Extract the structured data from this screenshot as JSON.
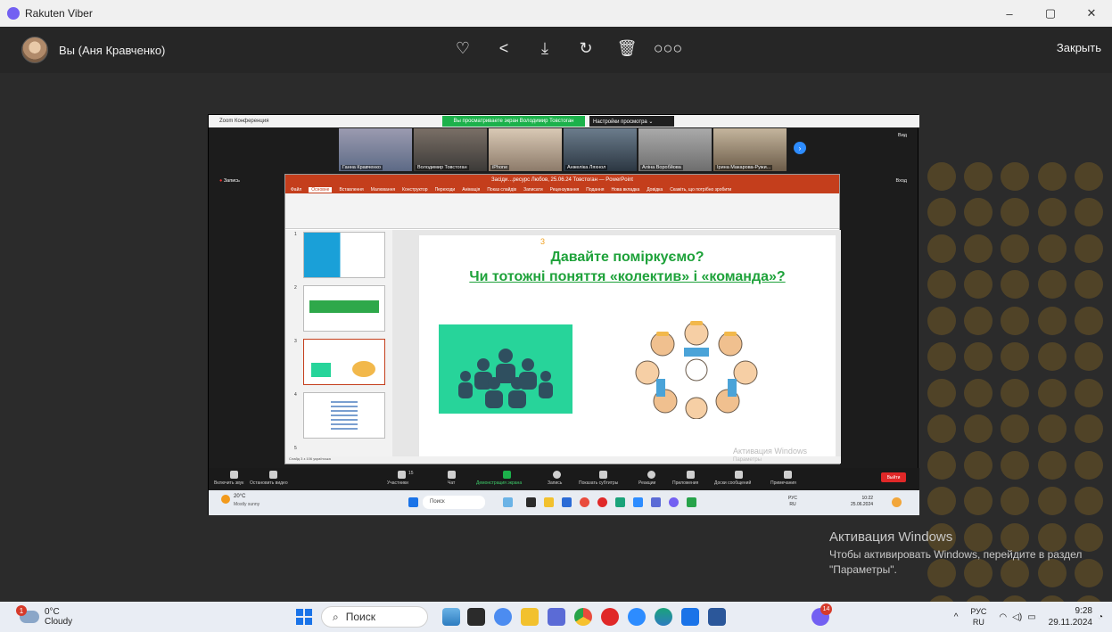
{
  "window": {
    "title": "Rakuten Viber",
    "controls": [
      "–",
      "▢",
      "✕"
    ]
  },
  "viewer": {
    "sender": "Вы (Аня Кравченко)",
    "close_label": "Закрыть",
    "tools": [
      "heart-icon",
      "share-icon",
      "download-icon",
      "rotate-icon",
      "trash-icon",
      "more-icon"
    ]
  },
  "screenshot": {
    "zoom_title": "Zoom Конференция",
    "share_banner": "Вы просматриваете экран Володимир Товстоган",
    "view_options": "Настройки просмотра ⌄",
    "record_label": "Запись",
    "vid_label": "Вид",
    "exit_label": "Вход",
    "participants": [
      {
        "name": "Ганна Кравченко"
      },
      {
        "name": "Володимир Товстоган"
      },
      {
        "name": "iPhone"
      },
      {
        "name": "Анжеліка Ляхнол"
      },
      {
        "name": "Аліна Воробйова"
      },
      {
        "name": "Ірина Макарова-Ружи..."
      }
    ],
    "ppt": {
      "title": "Засіди…ресурс Любов, 25.06.24 Товстоган — PowerPoint",
      "tabs": [
        "Файл",
        "Основне",
        "Вставлення",
        "Малювання",
        "Конструктор",
        "Переходи",
        "Анімація",
        "Показ слайдів",
        "Записати",
        "Рецензування",
        "Подання",
        "Нова вкладка",
        "Довідка",
        "Скажіть, що потрібно зробити"
      ],
      "slide_number": "3",
      "line1": "Давайте поміркуємо?",
      "line2": "Чи тотожні поняття «колектив» і «команда»?",
      "status": "Слайд 3 з 106   українська",
      "thumb_numbers": [
        "1",
        "2",
        "3",
        "4",
        "5"
      ]
    },
    "toolbar": [
      {
        "label": "Включить звук"
      },
      {
        "label": "Остановить видео"
      },
      {
        "label": "Участники"
      },
      {
        "label": "Чат"
      },
      {
        "label": "Демонстрация экрана"
      },
      {
        "label": "Запись"
      },
      {
        "label": "Показать субтитры"
      },
      {
        "label": "Реакции"
      },
      {
        "label": "Приложения"
      },
      {
        "label": "Доски сообщений"
      },
      {
        "label": "Примечания"
      }
    ],
    "participants_count": "15",
    "leave_label": "Выйти",
    "inner_weather": "20°C",
    "inner_weather_desc": "Mostly sunny",
    "inner_search": "Поиск",
    "inner_lang": "РУС",
    "inner_lang2": "RU",
    "inner_time": "10:22",
    "inner_date": "25.06.2024",
    "inner_activate": "Активация Windows",
    "inner_activate2": "Параметры"
  },
  "activation": {
    "line1": "Активация Windows",
    "line2": "Чтобы активировать Windows, перейдите в раздел",
    "line3": "\"Параметры\"."
  },
  "taskbar": {
    "weather_temp": "0°C",
    "weather_desc": "Cloudy",
    "weather_badge": "1",
    "search_placeholder": "Поиск",
    "viber_badge": "14",
    "lang_top": "РУС",
    "lang_bottom": "RU",
    "time": "9:28",
    "date": "29.11.2024"
  }
}
